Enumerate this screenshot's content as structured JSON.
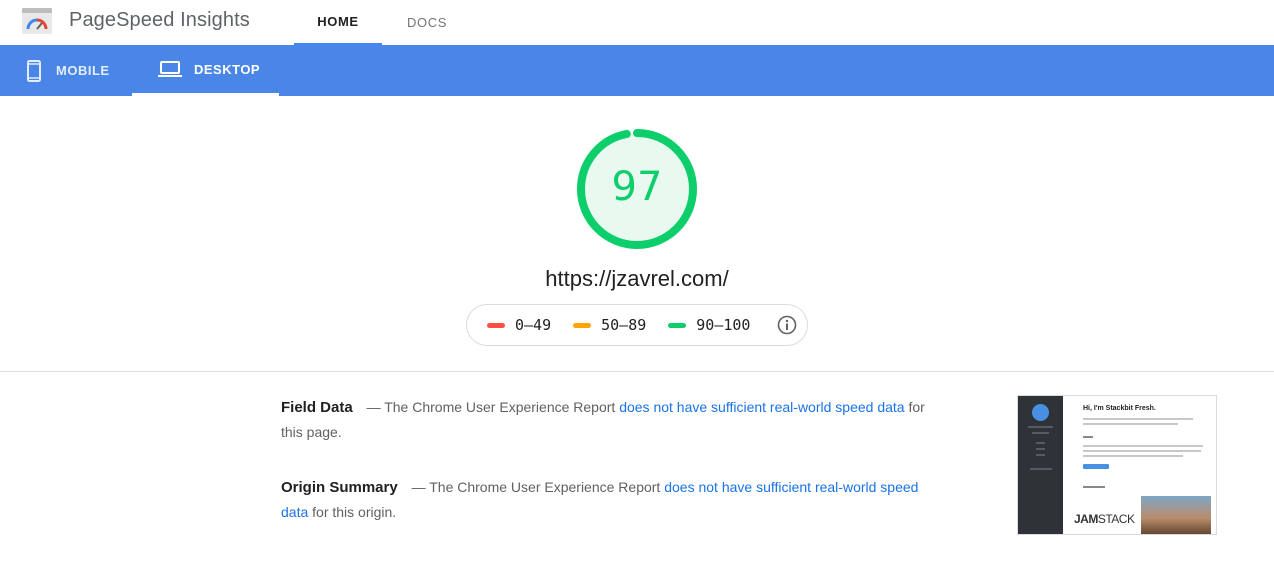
{
  "app": {
    "title": "PageSpeed Insights",
    "logo_icon": "pagespeed-gauge-icon"
  },
  "nav": {
    "tabs": [
      {
        "label": "HOME",
        "active": true
      },
      {
        "label": "DOCS",
        "active": false
      }
    ]
  },
  "device_tabs": [
    {
      "label": "MOBILE",
      "icon": "smartphone-icon",
      "active": false
    },
    {
      "label": "DESKTOP",
      "icon": "laptop-icon",
      "active": true
    }
  ],
  "score": {
    "value": "97",
    "fraction": 0.97,
    "color": "#0cce6b",
    "fill": "#e8f9f0"
  },
  "url": "https://jzavrel.com/",
  "legend": {
    "items": [
      {
        "label": "0–49",
        "color": "#ff4e42"
      },
      {
        "label": "50–89",
        "color": "#ffa400"
      },
      {
        "label": "90–100",
        "color": "#0cce6b"
      }
    ],
    "info_icon": "info-icon"
  },
  "field_data": {
    "title": "Field Data",
    "prefix": "— The Chrome User Experience Report",
    "link": "does not have sufficient real-world speed data",
    "suffix": "for this page."
  },
  "origin_summary": {
    "title": "Origin Summary",
    "prefix": "— The Chrome User Experience Report",
    "link": "does not have sufficient real-world speed data",
    "suffix": "for this origin."
  },
  "thumbnail": {
    "heading": "Hi, I'm Stackbit Fresh.",
    "jam_bold": "JAM",
    "jam_rest": "STACK"
  }
}
